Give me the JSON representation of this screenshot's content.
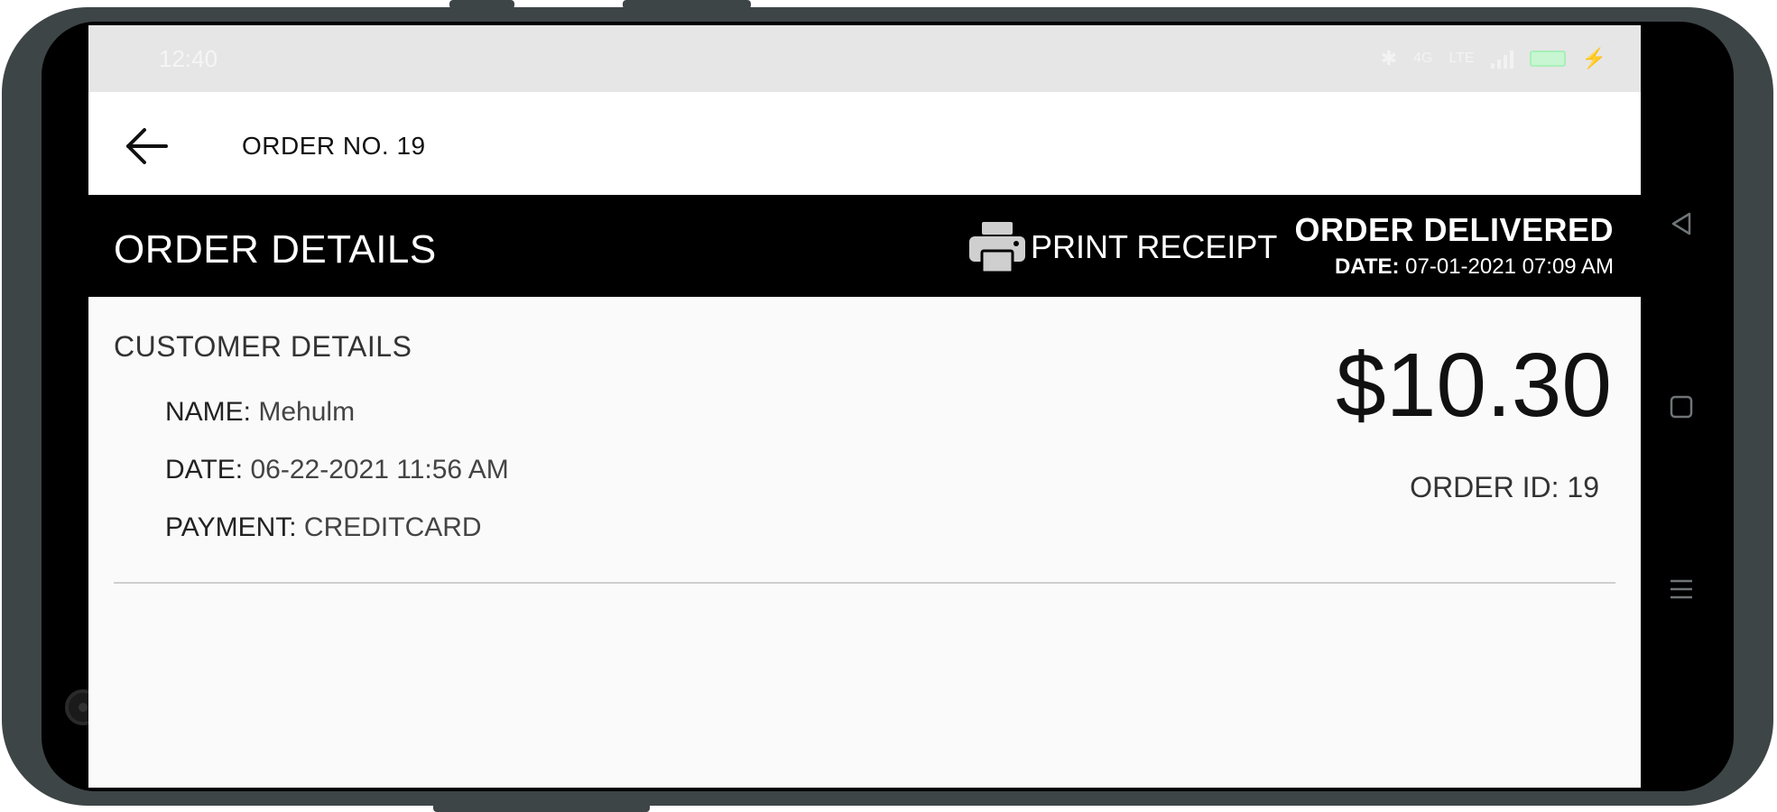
{
  "status_bar": {
    "time": "12:40",
    "net_a": "4G",
    "net_b": "LTE"
  },
  "app_bar": {
    "title": "ORDER NO. 19"
  },
  "detail_header": {
    "title": "ORDER DETAILS",
    "print_label": "PRINT RECEIPT",
    "order_status": "ORDER DELIVERED",
    "date_label": "DATE:",
    "date_value": "07-01-2021 07:09 AM"
  },
  "customer": {
    "heading": "CUSTOMER DETAILS",
    "name_label": "NAME:",
    "name_value": "Mehulm",
    "date_label": "DATE:",
    "date_value": "06-22-2021 11:56 AM",
    "payment_label": "PAYMENT:",
    "payment_value": "CREDITCARD"
  },
  "order": {
    "amount": "$10.30",
    "id_text": "ORDER ID: 19"
  },
  "icons": {
    "back": "arrow-left-icon",
    "print": "printer-icon",
    "nav_back": "triangle-back-icon",
    "nav_home": "square-home-icon",
    "nav_menu": "menu-lines-icon"
  },
  "colors": {
    "header_bg": "#000000",
    "screen_bg": "#fafafa",
    "frame": "#3e4547",
    "charging": "#3ddc5c"
  }
}
